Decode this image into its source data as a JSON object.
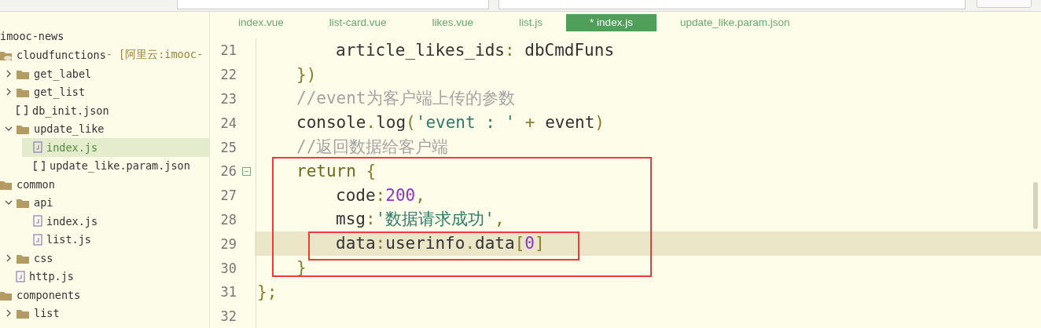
{
  "sidebar": {
    "project": "imooc-news",
    "tree": [
      {
        "name": "cloudfunctions",
        "suffix": " - [阿里云:imooc-",
        "kind": "cloud-folder",
        "selected": false,
        "children": [
          {
            "name": "get_label",
            "kind": "folder",
            "expanded": false,
            "selected": false
          },
          {
            "name": "get_list",
            "kind": "folder",
            "expanded": false,
            "selected": false
          },
          {
            "name": "db_init.json",
            "kind": "json",
            "selected": false
          },
          {
            "name": "update_like",
            "kind": "folder",
            "expanded": true,
            "selected": false,
            "children": [
              {
                "name": "index.js",
                "kind": "js",
                "selected": true
              },
              {
                "name": "update_like.param.json",
                "kind": "json",
                "selected": false
              }
            ]
          }
        ]
      },
      {
        "name": "common",
        "kind": "folder",
        "selected": false,
        "children": [
          {
            "name": "api",
            "kind": "folder",
            "expanded": true,
            "selected": false,
            "children": [
              {
                "name": "index.js",
                "kind": "js",
                "selected": false
              },
              {
                "name": "list.js",
                "kind": "js",
                "selected": false
              }
            ]
          },
          {
            "name": "css",
            "kind": "folder",
            "expanded": false,
            "selected": false
          },
          {
            "name": "http.js",
            "kind": "js",
            "selected": false
          }
        ]
      },
      {
        "name": "components",
        "kind": "folder",
        "selected": false,
        "children": [
          {
            "name": "list",
            "kind": "folder",
            "expanded": false,
            "selected": false
          }
        ]
      }
    ]
  },
  "tabs": [
    {
      "label": "index.vue",
      "selected": false
    },
    {
      "label": "list-card.vue",
      "selected": false
    },
    {
      "label": "likes.vue",
      "selected": false
    },
    {
      "label": "list.js",
      "selected": false
    },
    {
      "label": "* index.js",
      "selected": true
    },
    {
      "label": "update_like.param.json",
      "selected": false
    }
  ],
  "code": {
    "lines": [
      {
        "children": [
          {
            "children": [
              {
                "number": "21",
                "current": false,
                "tokens": [
                  {
                    "text": "article_likes_ids",
                    "kind": "plain"
                  },
                  {
                    "text": ":",
                    "kind": "punct"
                  },
                  {
                    "text": " dbCmdFuns",
                    "kind": "plain"
                  }
                ]
              }
            ]
          },
          {
            "number": "22",
            "current": false,
            "tokens": [
              {
                "text": "})",
                "kind": "punct"
              }
            ]
          },
          {
            "number": "23",
            "current": false,
            "tokens": [
              {
                "text": "//event为客户端上传的参数",
                "kind": "comment"
              }
            ]
          },
          {
            "number": "24",
            "current": false,
            "tokens": [
              {
                "text": "console",
                "kind": "plain"
              },
              {
                "text": ".",
                "kind": "punct"
              },
              {
                "text": "log",
                "kind": "plain"
              },
              {
                "text": "(",
                "kind": "punct"
              },
              {
                "text": "'event : '",
                "kind": "str"
              },
              {
                "text": " + ",
                "kind": "punct"
              },
              {
                "text": "event",
                "kind": "plain"
              },
              {
                "text": ")",
                "kind": "punct"
              }
            ]
          },
          {
            "number": "25",
            "current": false,
            "tokens": [
              {
                "text": "//返回数据给客户端",
                "kind": "comment"
              }
            ]
          },
          {
            "number": "26",
            "current": false,
            "folded": false,
            "tokens": [
              {
                "text": "return",
                "kind": "kw"
              },
              {
                "text": " {",
                "kind": "punct"
              }
            ]
          },
          {
            "children": [
              {
                "number": "27",
                "current": false,
                "tokens": [
                  {
                    "text": "code",
                    "kind": "plain"
                  },
                  {
                    "text": ":",
                    "kind": "punct"
                  },
                  {
                    "text": "200",
                    "kind": "num"
                  },
                  {
                    "text": ",",
                    "kind": "punct"
                  }
                ]
              },
              {
                "number": "28",
                "current": false,
                "tokens": [
                  {
                    "text": "msg",
                    "kind": "plain"
                  },
                  {
                    "text": ":",
                    "kind": "punct"
                  },
                  {
                    "text": "'数据请求成功'",
                    "kind": "str"
                  },
                  {
                    "text": ",",
                    "kind": "punct"
                  }
                ]
              },
              {
                "number": "29",
                "current": true,
                "tokens": [
                  {
                    "text": "data",
                    "kind": "plain"
                  },
                  {
                    "text": ":",
                    "kind": "punct"
                  },
                  {
                    "text": "userinfo",
                    "kind": "plain"
                  },
                  {
                    "text": ".",
                    "kind": "punct"
                  },
                  {
                    "text": "data",
                    "kind": "plain"
                  },
                  {
                    "text": "[",
                    "kind": "punct"
                  },
                  {
                    "text": "0",
                    "kind": "num"
                  },
                  {
                    "text": "]",
                    "kind": "punct"
                  }
                ]
              }
            ]
          },
          {
            "number": "30",
            "current": false,
            "tokens": [
              {
                "text": "}",
                "kind": "punct"
              }
            ]
          }
        ]
      },
      {
        "number": "31",
        "current": false,
        "tokens": [
          {
            "text": "};",
            "kind": "punct"
          }
        ]
      },
      {
        "number": "32",
        "current": false
      }
    ]
  }
}
